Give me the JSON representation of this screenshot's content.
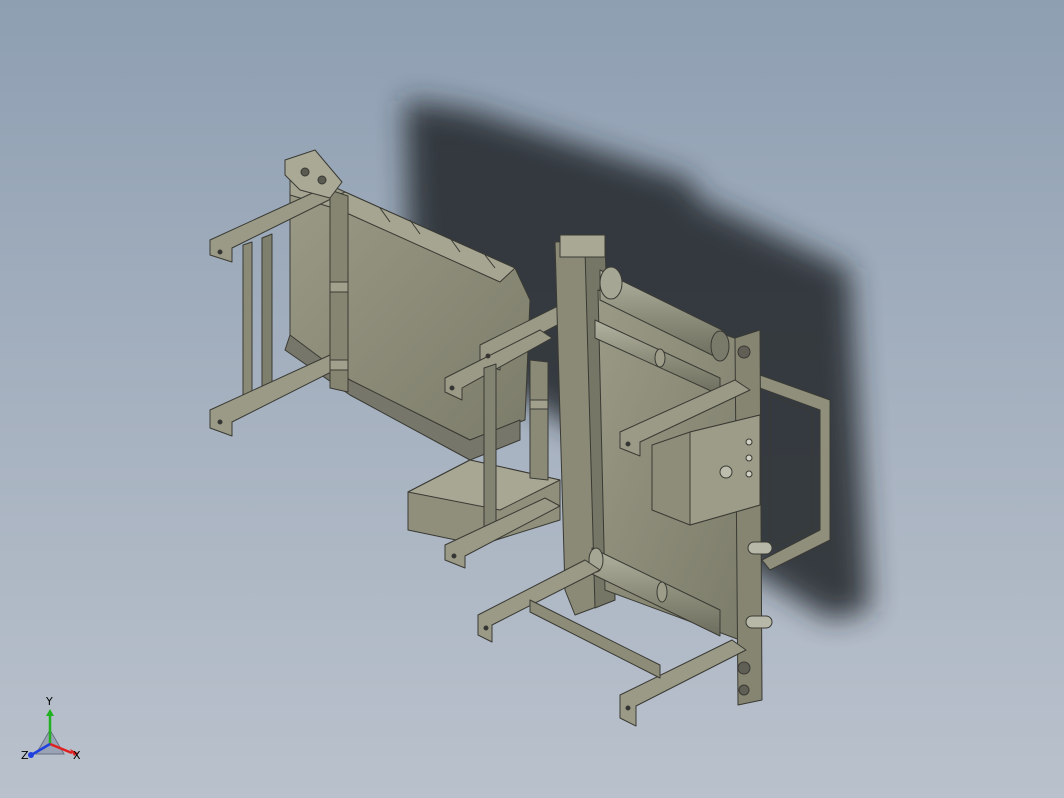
{
  "viewport": {
    "background_top": "#8e9fb2",
    "background_bottom": "#b9c1cc",
    "model_color": "#8c8c78",
    "model_edge_color": "#3a3a34",
    "shadow_color": "#1e1f24"
  },
  "triad": {
    "x_label": "X",
    "y_label": "Y",
    "z_label": "Z",
    "x_color": "#e02020",
    "y_color": "#20b020",
    "z_color": "#2040e0"
  }
}
